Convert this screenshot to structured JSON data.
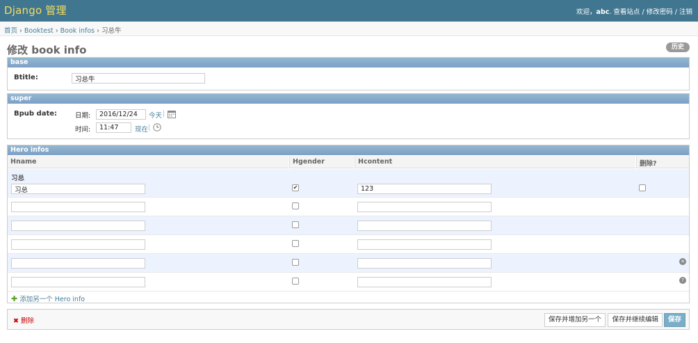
{
  "header": {
    "site_title": "Django 管理",
    "welcome": "欢迎，",
    "username": "abc",
    "view_site": "查看站点",
    "change_password": "修改密码",
    "logout": "注销",
    "sep1": "/",
    "sep2": "/"
  },
  "breadcrumbs": {
    "home": "首页",
    "app": "Booktest",
    "model": "Book infos",
    "current": "习总牛",
    "sep": "›"
  },
  "page": {
    "title": "修改 book info",
    "history_label": "历史"
  },
  "fieldsets": {
    "base": {
      "title": "base",
      "btitle_label": "Btitle:",
      "btitle_value": "习总牛"
    },
    "super": {
      "title": "super",
      "bpub_label": "Bpub date:",
      "date_label": "日期:",
      "date_value": "2016/12/24",
      "today_link": "今天",
      "time_label": "时间:",
      "time_value": "11:47",
      "now_link": "现在",
      "sep": "|"
    }
  },
  "inline": {
    "title": "Hero infos",
    "columns": {
      "hname": "Hname",
      "hgender": "Hgender",
      "hcontent": "Hcontent",
      "delete": "删除?"
    },
    "rows": [
      {
        "original": "习总",
        "hname": "习总",
        "hgender": true,
        "hcontent": "123",
        "has_delete_checkbox": true
      },
      {
        "original": "",
        "hname": "",
        "hgender": false,
        "hcontent": ""
      },
      {
        "original": "",
        "hname": "",
        "hgender": false,
        "hcontent": ""
      },
      {
        "original": "",
        "hname": "",
        "hgender": false,
        "hcontent": ""
      },
      {
        "original": "",
        "hname": "",
        "hgender": false,
        "hcontent": "",
        "row_icon": "remove-icon"
      },
      {
        "original": "",
        "hname": "",
        "hgender": false,
        "hcontent": "",
        "row_icon": "help-icon"
      }
    ],
    "add_another": "添加另一个 Hero info"
  },
  "submit": {
    "delete_label": "删除",
    "save_add_another": "保存并增加另一个",
    "save_continue": "保存并继续编辑",
    "save": "保存"
  },
  "colors": {
    "header_bg": "#417690",
    "brand": "#f5dd5d",
    "module_header": "#7ca0c7",
    "link": "#447e9b",
    "row_alt": "#edf3fe"
  }
}
